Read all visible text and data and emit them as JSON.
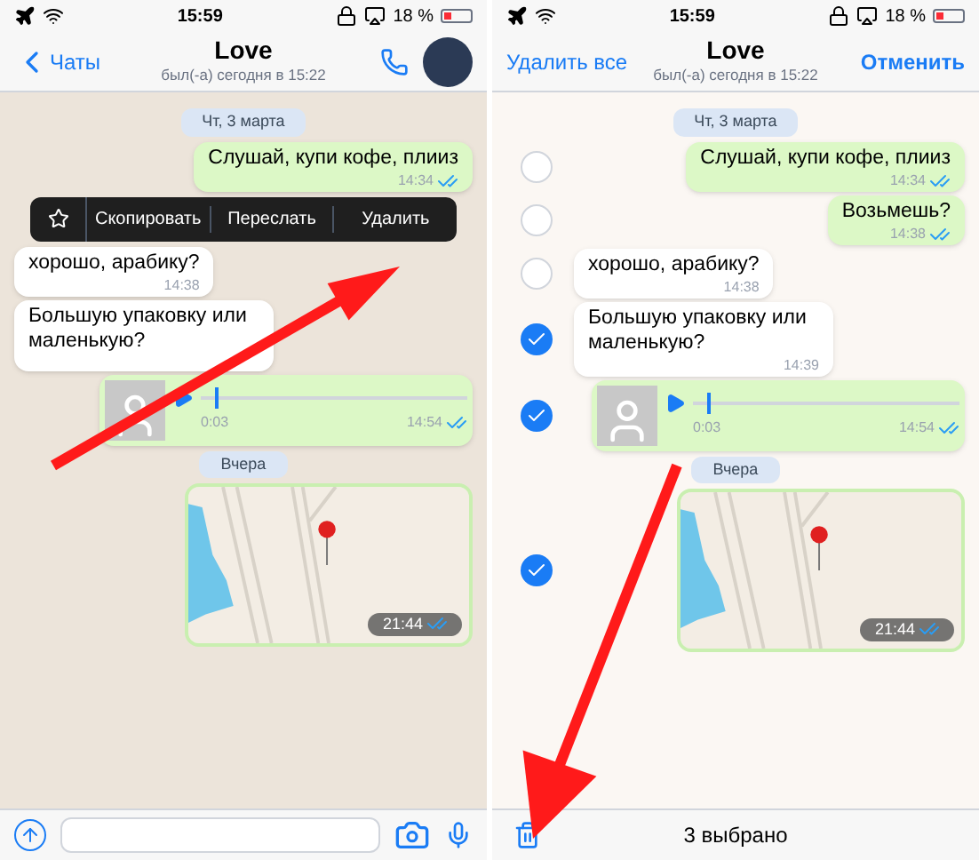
{
  "screens": [
    {
      "kind": "chat",
      "status_bar": {
        "time": "15:59",
        "battery": "18 %"
      },
      "header": {
        "back": "Чаты",
        "title": "Love",
        "subtitle": "был(-а) сегодня в 15:22"
      },
      "messages": [
        {
          "kind": "date",
          "text": "Чт, 3 марта"
        },
        {
          "kind": "text",
          "outgoing": true,
          "text": "Слушай, купи кофе, плииз",
          "time": "14:34",
          "read": true
        },
        {
          "kind": "menu",
          "items": [
            "Скопировать",
            "Переслать",
            "Удалить"
          ]
        },
        {
          "kind": "text",
          "outgoing": false,
          "text": "хорошо, арабику?",
          "time": "14:38"
        },
        {
          "kind": "text",
          "outgoing": false,
          "text": "Большую упаковку или маленькую?"
        },
        {
          "kind": "voice",
          "outgoing": true,
          "duration": "0:03",
          "time": "14:54",
          "read": true,
          "level": 0.05
        },
        {
          "kind": "date",
          "text": "Вчера"
        },
        {
          "kind": "location",
          "outgoing": true,
          "time": "21:44",
          "read": true
        }
      ],
      "footer": {
        "kind": "input"
      }
    },
    {
      "kind": "select",
      "status_bar": {
        "time": "15:59",
        "battery": "18 %"
      },
      "header": {
        "left": "Удалить все",
        "title": "Love",
        "subtitle": "был(-а) сегодня в 15:22",
        "right": "Отменить"
      },
      "messages": [
        {
          "kind": "date",
          "text": "Чт, 3 марта"
        },
        {
          "kind": "text",
          "outgoing": true,
          "text": "Слушай, купи кофе, плииз",
          "time": "14:34",
          "read": true,
          "selected": false
        },
        {
          "kind": "text",
          "outgoing": true,
          "text": "Возьмешь?",
          "time": "14:38",
          "read": true,
          "selected": false
        },
        {
          "kind": "text",
          "outgoing": false,
          "text": "хорошо, арабику?",
          "time": "14:38",
          "selected": false
        },
        {
          "kind": "text",
          "outgoing": false,
          "text": "Большую упаковку или маленькую?",
          "time": "14:39",
          "selected": true
        },
        {
          "kind": "voice",
          "outgoing": true,
          "duration": "0:03",
          "time": "14:54",
          "read": true,
          "level": 0.05,
          "selected": true
        },
        {
          "kind": "date",
          "text": "Вчера"
        },
        {
          "kind": "location",
          "outgoing": true,
          "time": "21:44",
          "read": true,
          "selected": true
        }
      ],
      "footer": {
        "kind": "selection",
        "count": "3 выбрано"
      }
    }
  ]
}
